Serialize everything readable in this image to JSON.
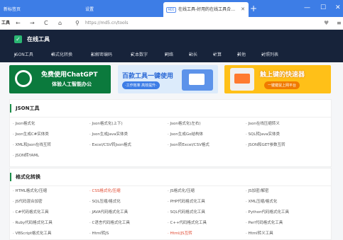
{
  "browser": {
    "tabs": [
      {
        "label": "新标签页"
      },
      {
        "label": "设置"
      },
      {
        "label": "在线工具-好用的在线工具合…",
        "icon_text": "MD5"
      }
    ],
    "active_tab_index": 2,
    "url": "https://md5.cn/tools",
    "profile_label": "工具"
  },
  "site": {
    "name": "在线工具",
    "menu": [
      "JSON工具",
      "格式化转换",
      "加解密编码",
      "文本数字",
      "网络",
      "站长",
      "计算",
      "其他",
      "对照列表"
    ]
  },
  "banners": [
    {
      "line1": "免费使用ChatGPT",
      "line2": "体验人工智能办公"
    },
    {
      "line1": "百款工具一键使用",
      "line2": "·工作效率 高效提升·"
    },
    {
      "line1": "触上键的快速器",
      "line2": "一键键鼠上网平台"
    }
  ],
  "sections": [
    {
      "title": "JSON工具",
      "items": [
        {
          "label": "Json格式化"
        },
        {
          "label": "Json格式化(上下)"
        },
        {
          "label": "Json格式化(左右)"
        },
        {
          "label": "Json在线压缩转义"
        },
        {
          "label": "Json生成C#实体类"
        },
        {
          "label": "Json生成Java实体类"
        },
        {
          "label": "Json生成Go结构体"
        },
        {
          "label": "SQL转Java实体类"
        },
        {
          "label": "XML和Json在线互转"
        },
        {
          "label": "Excel/CSV转Json格式"
        },
        {
          "label": "Json转Excel/CSV格式"
        },
        {
          "label": "JSON和GET参数互转"
        },
        {
          "label": "JSON转YAML"
        }
      ]
    },
    {
      "title": "格式化转换",
      "items": [
        {
          "label": "HTML格式化/压缩"
        },
        {
          "label": "CSS格式化/压缩",
          "highlight": true
        },
        {
          "label": "JS格式化/压缩"
        },
        {
          "label": "JS加密/解密"
        },
        {
          "label": "JS代码混合加密"
        },
        {
          "label": "SQL压缩/格式化"
        },
        {
          "label": "PHP代码格式化工具"
        },
        {
          "label": "XML压缩/格式化"
        },
        {
          "label": "C#代码格式化工具"
        },
        {
          "label": "JAVA代码格式化工具"
        },
        {
          "label": "SQL代码格式化工具"
        },
        {
          "label": "Python代码格式化工具"
        },
        {
          "label": "Ruby代码格式化工具"
        },
        {
          "label": "C语言代码格式化工具"
        },
        {
          "label": "C++代码格式化工具"
        },
        {
          "label": "Perl代码格式化工具"
        },
        {
          "label": "VBScript格式化工具"
        },
        {
          "label": "Html转JS"
        },
        {
          "label": "Html/JS互转",
          "highlight": true
        },
        {
          "label": "Html转义工具"
        }
      ]
    }
  ],
  "colors": {
    "tabstrip": "#3d7de6",
    "header": "#17233a",
    "accent_green": "#1b8e4a",
    "highlight_red": "#e0482f"
  }
}
